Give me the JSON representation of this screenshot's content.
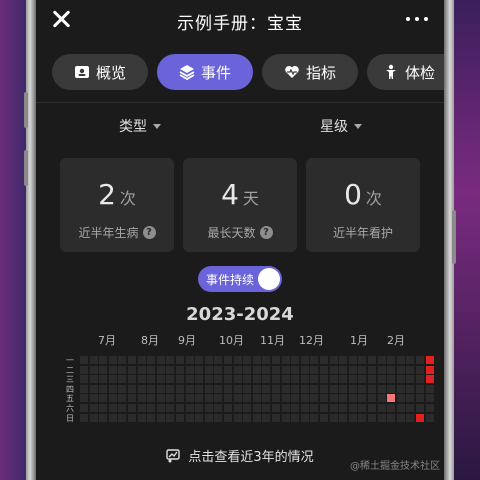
{
  "header": {
    "close_icon": "close-icon",
    "title": "示例手册：宝宝",
    "more_icon": "more-dots-icon"
  },
  "tabs": [
    {
      "label": "概览",
      "icon": "id-card-icon",
      "active": false
    },
    {
      "label": "事件",
      "icon": "layers-icon",
      "active": true
    },
    {
      "label": "指标",
      "icon": "heart-chart-icon",
      "active": false
    },
    {
      "label": "体检",
      "icon": "person-icon",
      "active": false
    }
  ],
  "filters": {
    "type_label": "类型",
    "rating_label": "星级"
  },
  "stats": [
    {
      "value": "2",
      "unit": "次",
      "label": "近半年生病",
      "help": true
    },
    {
      "value": "4",
      "unit": "天",
      "label": "最长天数",
      "help": true
    },
    {
      "value": "0",
      "unit": "次",
      "label": "近半年看护",
      "help": false
    }
  ],
  "toggle": {
    "label": "事件持续",
    "on": true
  },
  "calendar": {
    "year_range": "2023-2024",
    "months": [
      "7月",
      "8月",
      "9月",
      "10月",
      "11月",
      "12月",
      "1月",
      "2月"
    ],
    "weekdays": [
      "一",
      "二",
      "三",
      "四",
      "五",
      "六",
      "日"
    ],
    "weeks": 37,
    "highlights": [
      {
        "week": 36,
        "day": 0,
        "color": "#e0211f"
      },
      {
        "week": 36,
        "day": 1,
        "color": "#e0211f"
      },
      {
        "week": 36,
        "day": 2,
        "color": "#e0211f"
      },
      {
        "week": 32,
        "day": 4,
        "color": "#f07878"
      },
      {
        "week": 35,
        "day": 6,
        "color": "#e0211f"
      }
    ]
  },
  "footer": {
    "link_text": "点击查看近3年的情况",
    "icon": "chart-history-icon"
  },
  "watermark": "@稀土掘金技术社区",
  "colors": {
    "accent": "#6b63d9",
    "tab_bg": "#3a3a3a",
    "event_red": "#e0211f"
  }
}
